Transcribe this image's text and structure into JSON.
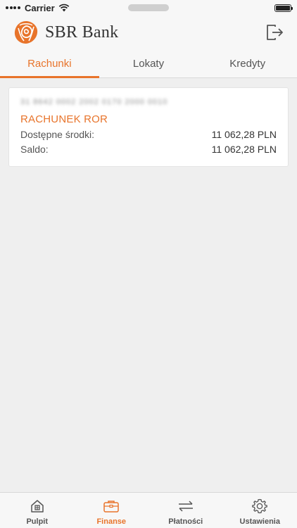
{
  "status": {
    "carrier": "Carrier"
  },
  "header": {
    "brand": "SBR Bank"
  },
  "tabs": [
    {
      "label": "Rachunki",
      "active": true
    },
    {
      "label": "Lokaty",
      "active": false
    },
    {
      "label": "Kredyty",
      "active": false
    }
  ],
  "account": {
    "number_masked": "31 8642 0002 2002 0170 2000 0010",
    "name": "RACHUNEK ROR",
    "available_label": "Dostępne środki:",
    "available_value": "11 062,28 PLN",
    "balance_label": "Saldo:",
    "balance_value": "11 062,28 PLN"
  },
  "bottom_nav": [
    {
      "label": "Pulpit",
      "icon": "home-icon",
      "active": false
    },
    {
      "label": "Finanse",
      "icon": "briefcase-icon",
      "active": true
    },
    {
      "label": "Płatności",
      "icon": "transfer-arrows-icon",
      "active": false
    },
    {
      "label": "Ustawienia",
      "icon": "gear-icon",
      "active": false
    }
  ],
  "colors": {
    "accent": "#e8742b",
    "background": "#efefef",
    "bar": "#f7f7f7"
  }
}
